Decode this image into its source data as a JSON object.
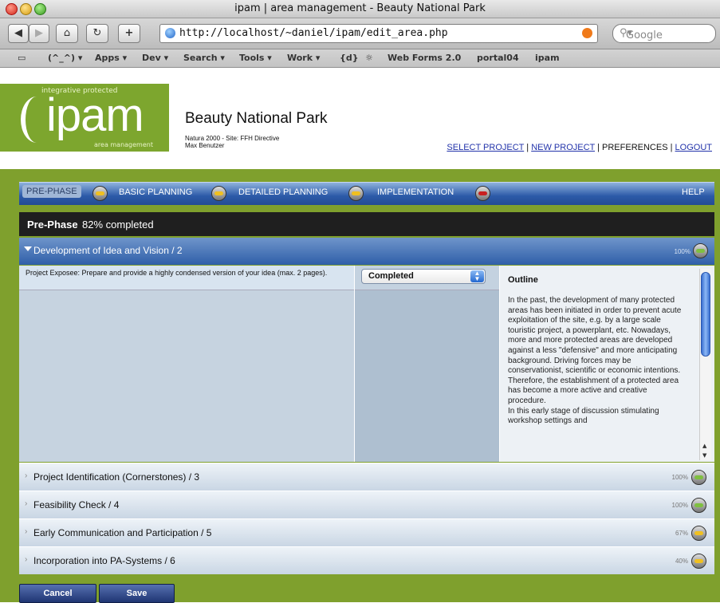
{
  "browser": {
    "window_title": "ipam | area management - Beauty National Park",
    "url": "http://localhost/~daniel/ipam/edit_area.php",
    "search_placeholder": "Google",
    "bookmarks": [
      "(^_^) ▾",
      "Apps ▾",
      "Dev ▾",
      "Search ▾",
      "Tools ▾",
      "Work ▾",
      "{d}",
      "☼",
      "Web Forms 2.0",
      "portal04",
      "ipam"
    ]
  },
  "logo": {
    "tagline": "integrative protected",
    "name": "ipam",
    "subtitle": "area management"
  },
  "header": {
    "park_title": "Beauty National Park",
    "natura_line": "Natura 2000  -  Site: FFH Directive",
    "user_name": "Max Benutzer",
    "links": {
      "select_project": "SELECT PROJECT",
      "new_project": "NEW PROJECT",
      "preferences": "PREFERENCES",
      "logout": "LOGOUT",
      "separator": "|"
    }
  },
  "tabs": {
    "pre_phase": "PRE-PHASE",
    "basic_planning": "BASIC PLANNING",
    "detailed_planning": "DETAILED PLANNING",
    "implementation": "IMPLEMENTATION",
    "help": "HELP"
  },
  "phase": {
    "name": "Pre-Phase",
    "completion_text": "82% completed",
    "completion_value": 82
  },
  "open_section": {
    "title": "Development of Idea and Vision / 2",
    "percent": "100%",
    "task_text": "Project Exposee: Prepare and provide a highly condensed version of your idea (max. 2 pages).",
    "status_value": "Completed",
    "outline_heading": "Outline",
    "outline_text": "In the past, the development of many protected areas has been initiated in order to prevent acute exploitation of the site, e.g. by a large scale touristic project, a powerplant, etc. Nowadays, more and more protected areas are developed against a less \"defensive\" and more anticipating background. Driving forces may be conservationist, scientific or economic intentions. Therefore, the establishment of a protected area has become a more active and creative procedure.\nIn this early stage of discussion stimulating workshop settings and"
  },
  "sections": [
    {
      "title": "Project Identification (Cornerstones) / 3",
      "percent": "100%",
      "status": "green"
    },
    {
      "title": "Feasibility Check / 4",
      "percent": "100%",
      "status": "green"
    },
    {
      "title": "Early Communication and Participation / 5",
      "percent": "67%",
      "status": "yellow"
    },
    {
      "title": "Incorporation into PA-Systems / 6",
      "percent": "40%",
      "status": "yellow"
    }
  ],
  "buttons": {
    "cancel": "Cancel",
    "save": "Save"
  },
  "colors": {
    "brand_green": "#7fa02d",
    "nav_blue": "#2c5aa8",
    "phase_bar": "#1f1f1f",
    "link_blue": "#2233aa"
  }
}
